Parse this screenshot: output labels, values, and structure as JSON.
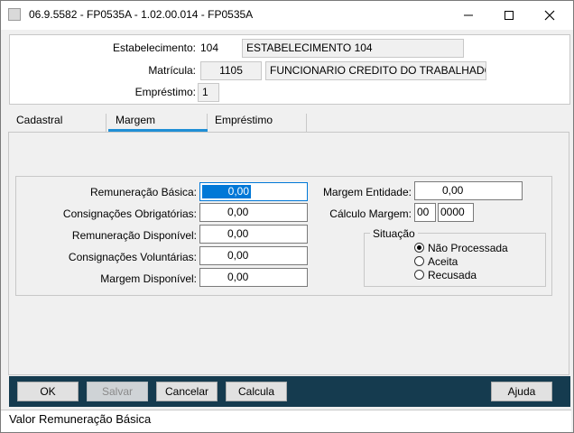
{
  "window": {
    "title": "06.9.5582 - FP0535A - 1.02.00.014 - FP0535A",
    "minimize_icon": "minimize-icon",
    "maximize_icon": "maximize-icon",
    "close_icon": "close-icon"
  },
  "header": {
    "estabelecimento_label": "Estabelecimento:",
    "estabelecimento_code": "104",
    "estabelecimento_name": "ESTABELECIMENTO 104",
    "matricula_label": "Matrícula:",
    "matricula_code": "1105",
    "matricula_name": "FUNCIONARIO CREDITO  DO TRABALHADOR",
    "emprestimo_label": "Empréstimo:",
    "emprestimo_value": "1"
  },
  "tabs": [
    {
      "label": "Cadastral",
      "selected": false
    },
    {
      "label": "Margem",
      "selected": true
    },
    {
      "label": "Empréstimo",
      "selected": false
    }
  ],
  "margem": {
    "remuneracao_basica_label": "Remuneração Básica:",
    "remuneracao_basica_value": "0,00",
    "consignacoes_obrigatorias_label": "Consignações Obrigatórias:",
    "consignacoes_obrigatorias_value": "0,00",
    "remuneracao_disponivel_label": "Remuneração Disponível:",
    "remuneracao_disponivel_value": "0,00",
    "consignacoes_voluntarias_label": "Consignações Voluntárias:",
    "consignacoes_voluntarias_value": "0,00",
    "margem_disponivel_label": "Margem Disponível:",
    "margem_disponivel_value": "0,00",
    "margem_entidade_label": "Margem Entidade:",
    "margem_entidade_value": "0,00",
    "calculo_margem_label": "Cálculo Margem:",
    "calculo_margem_month": "00",
    "calculo_margem_year": "0000",
    "situacao_label": "Situação",
    "situacao_options": [
      {
        "label": "Não Processada",
        "selected": true
      },
      {
        "label": "Aceita",
        "selected": false
      },
      {
        "label": "Recusada",
        "selected": false
      }
    ]
  },
  "buttons": {
    "ok": "OK",
    "salvar": "Salvar",
    "cancelar": "Cancelar",
    "calcula": "Calcula",
    "ajuda": "Ajuda"
  },
  "status": {
    "text": "Valor Remuneração Básica"
  },
  "colors": {
    "tab_accent": "#1f8fd6",
    "button_bar": "#153b4f",
    "selection": "#0078d7"
  }
}
